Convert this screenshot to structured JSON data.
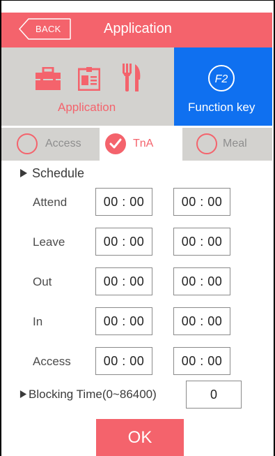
{
  "header": {
    "back_label": "BACK",
    "title": "Application"
  },
  "tiles": {
    "application_label": "Application",
    "function_key_label": "Function key",
    "function_key_badge": "F2"
  },
  "mode_tabs": [
    {
      "label": "Access",
      "selected": false
    },
    {
      "label": "TnA",
      "selected": true
    },
    {
      "label": "Meal",
      "selected": false
    }
  ],
  "schedule": {
    "title": "Schedule",
    "rows": [
      {
        "label": "Attend",
        "start": "00 : 00",
        "end": "00 : 00"
      },
      {
        "label": "Leave",
        "start": "00 : 00",
        "end": "00 : 00"
      },
      {
        "label": "Out",
        "start": "00 : 00",
        "end": "00 : 00"
      },
      {
        "label": "In",
        "start": "00 : 00",
        "end": "00 : 00"
      },
      {
        "label": "Access",
        "start": "00 : 00",
        "end": "00 : 00"
      }
    ]
  },
  "blocking": {
    "label": "Blocking Time(0~86400)",
    "value": "0"
  },
  "ok_label": "OK",
  "colors": {
    "accent": "#f4636c",
    "function_key_bg": "#0f70f0",
    "tile_bg": "#d3d2cf"
  },
  "icons": [
    "back-arrow-icon",
    "briefcase-icon",
    "id-card-icon",
    "fork-knife-icon",
    "f2-circle-icon",
    "checkmark-icon",
    "play-triangle-icon"
  ]
}
